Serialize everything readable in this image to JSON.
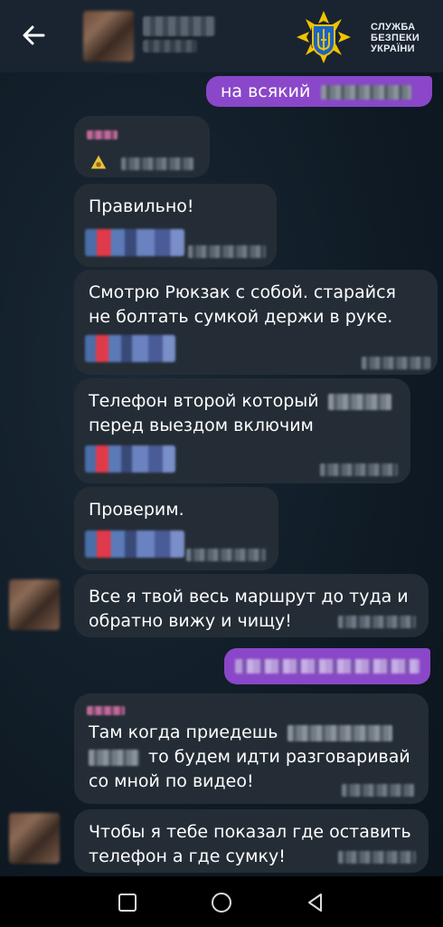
{
  "header": {
    "logo_lines": [
      "СЛУЖБА",
      "БЕЗПЕКИ",
      "УКРАЇНИ"
    ]
  },
  "messages": [
    {
      "direction": "out",
      "text": "на всякий"
    },
    {
      "direction": "in",
      "text": ""
    },
    {
      "direction": "in",
      "text": "Правильно!"
    },
    {
      "direction": "in",
      "text": "Смотрю Рюкзак с собой. старайся не болтать сумкой держи в руке."
    },
    {
      "direction": "in",
      "text_line1": "Телефон второй который",
      "text_line2": "перед выездом включим"
    },
    {
      "direction": "in",
      "text": "Проверим."
    },
    {
      "direction": "in",
      "text": "Все я твой весь маршрут до туда и обратно вижу и чищу!"
    },
    {
      "direction": "out",
      "text": ""
    },
    {
      "direction": "in",
      "text_line1": "Там когда приедешь",
      "text_line2": "то будем идти разговаривай",
      "text_line3": "со мной по видео!"
    },
    {
      "direction": "in",
      "text": "Чтобы я тебе показал где оставить телефон а где сумку!"
    }
  ],
  "colors": {
    "incoming_bubble": "#242d36",
    "outgoing_bubble": "#8a47c9",
    "header_bg": "#1a2430",
    "nav_bg": "#000000"
  },
  "navigation": {
    "buttons": [
      "recents-square-icon",
      "home-circle-icon",
      "back-triangle-icon"
    ]
  }
}
